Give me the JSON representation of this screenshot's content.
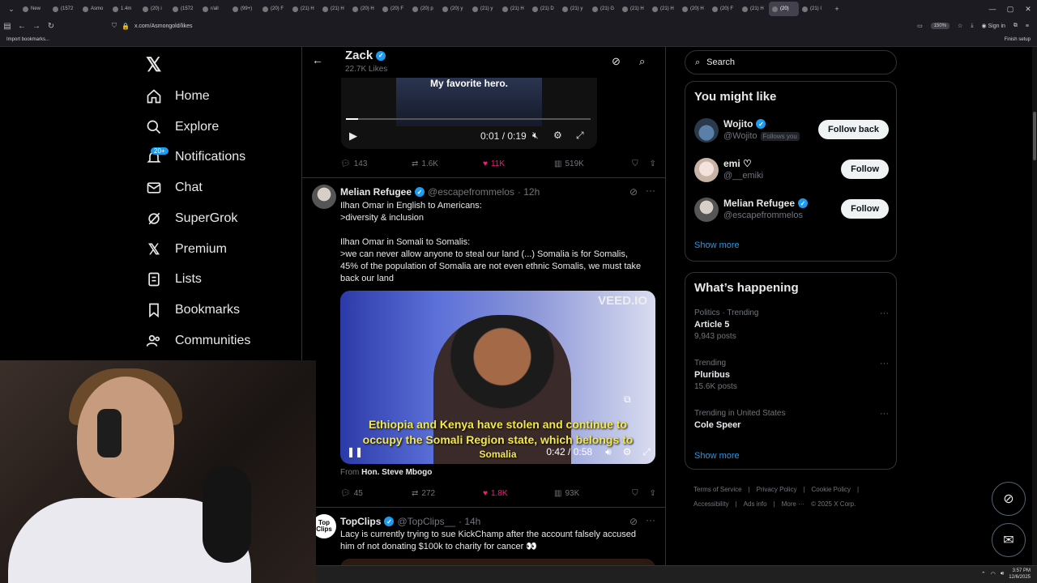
{
  "browser": {
    "tabs": [
      "New",
      "(1572",
      "Asmo",
      "1.4m",
      "(20) i",
      "(1572",
      "r/all",
      "(99+)",
      "(20) F",
      "(21) H",
      "(21) H",
      "(20) H",
      "(20) F",
      "(20) p",
      "(20) y",
      "(21) y",
      "(21) H",
      "(21) D",
      "(21) y",
      "(21) G",
      "(21) H",
      "(21) H",
      "(20) H",
      "(20) F",
      "(21) H",
      "(20)",
      "(21) I"
    ],
    "url": "x.com/Asmongold/likes",
    "zoom": "150%",
    "sign_in": "Sign in",
    "bookmark_import": "Import bookmarks...",
    "finish_setup": "Finish setup"
  },
  "sidebar": {
    "items": [
      {
        "label": "Home",
        "icon": "home-icon"
      },
      {
        "label": "Explore",
        "icon": "search-icon"
      },
      {
        "label": "Notifications",
        "icon": "bell-icon",
        "badge": "20+"
      },
      {
        "label": "Chat",
        "icon": "mail-icon"
      },
      {
        "label": "SuperGrok",
        "icon": "grok-icon"
      },
      {
        "label": "Premium",
        "icon": "x-icon"
      },
      {
        "label": "Lists",
        "icon": "list-icon"
      },
      {
        "label": "Bookmarks",
        "icon": "bookmark-icon"
      },
      {
        "label": "Communities",
        "icon": "people-icon"
      }
    ]
  },
  "header": {
    "name": "Zack",
    "subtitle": "22.7K Likes"
  },
  "video1": {
    "caption": "My favorite hero.",
    "time": "0:01 / 0:19",
    "progress": 0.05
  },
  "tweet0_actions": {
    "replies": "143",
    "reposts": "1.6K",
    "likes": "11K",
    "views": "519K"
  },
  "tweet1": {
    "name": "Melian Refugee",
    "handle": "@escapefrommelos",
    "time": "· 12h",
    "line1": "Ilhan Omar in English to Americans:",
    "line2": ">diversity & inclusion",
    "line3": "Ilhan Omar in Somali to Somalis:",
    "line4": ">we can never allow anyone to steal our land (...) Somalia is for Somalis, 45% of the population of Somalia are not even ethnic Somalis, we must take back our land",
    "video_watermark": "VEED.IO",
    "subtitle_line1": "Ethiopia and Kenya have stolen and continue to",
    "subtitle_line2": "occupy the Somali Region state, which belongs to",
    "subtitle_line3": "Somalia",
    "video_time": "0:42 / 0:58",
    "from_label": "From",
    "from_name": "Hon. Steve Mbogo",
    "replies": "45",
    "reposts": "272",
    "likes": "1.8K",
    "views": "93K"
  },
  "tweet2": {
    "name": "TopClips",
    "handle": "@TopClips__",
    "time": "· 14h",
    "text": "Lacy is currently trying to sue KickChamp after the account falsely accused him of not donating $100k to charity for cancer 👀",
    "avatar_text": "Top Clips"
  },
  "right": {
    "search_placeholder": "Search",
    "you_might_like": "You might like",
    "suggestions": [
      {
        "name": "Wojito",
        "handle": "@Wojito",
        "follows_you": "Follows you",
        "button": "Follow back",
        "verified": true
      },
      {
        "name": "emi ♡",
        "handle": "@__emiki",
        "follows_you": "",
        "button": "Follow",
        "verified": false
      },
      {
        "name": "Melian Refugee",
        "handle": "@escapefrommelos",
        "follows_you": "",
        "button": "Follow",
        "verified": true
      }
    ],
    "show_more": "Show more",
    "whats_happening": "What’s happening",
    "trends": [
      {
        "context": "Politics · Trending",
        "title": "Article 5",
        "posts": "9,943 posts"
      },
      {
        "context": "Trending",
        "title": "Pluribus",
        "posts": "15.6K posts"
      },
      {
        "context": "Trending in United States",
        "title": "Cole Speer",
        "posts": ""
      }
    ],
    "footer": [
      "Terms of Service",
      "|",
      "Privacy Policy",
      "|",
      "Cookie Policy",
      "|",
      "Accessibility",
      "|",
      "Ads info",
      "|",
      "More ···",
      "© 2025 X Corp."
    ]
  },
  "taskbar": {
    "time": "3:57 PM",
    "date": "12/6/2025"
  },
  "colors": {
    "accent": "#1d9bf0",
    "like": "#f91880",
    "background": "#000000",
    "border": "#2f3336"
  }
}
